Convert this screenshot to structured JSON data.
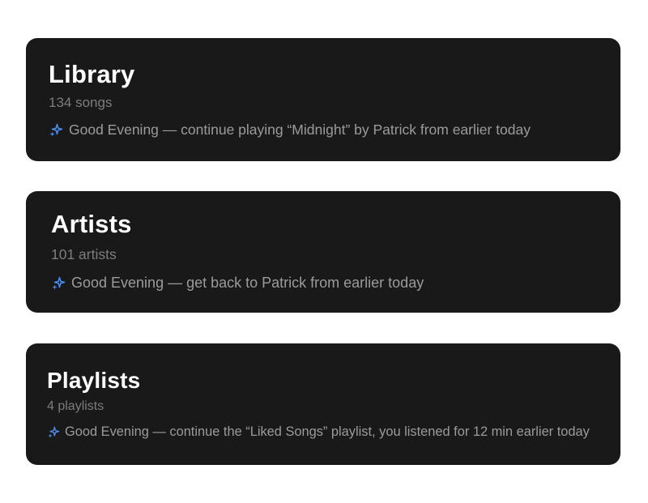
{
  "colors": {
    "page_background": "#ffffff",
    "card_background": "#19191a",
    "title_text": "#ffffff",
    "count_text": "#7d7d80",
    "suggestion_text": "#9b9b9e",
    "sparkle_accent": "#4a8ff0"
  },
  "cards": [
    {
      "title": "Library",
      "count": "134 songs",
      "suggestion_icon": "sparkle-icon",
      "suggestion": "Good Evening — continue playing “Midnight” by Patrick from earlier today"
    },
    {
      "title": "Artists",
      "count": "101 artists",
      "suggestion_icon": "sparkle-icon",
      "suggestion": "Good Evening — get back to Patrick from earlier today"
    },
    {
      "title": "Playlists",
      "count": "4 playlists",
      "suggestion_icon": "sparkle-icon",
      "suggestion": "Good Evening — continue the “Liked Songs” playlist, you listened for 12 min earlier today"
    }
  ]
}
